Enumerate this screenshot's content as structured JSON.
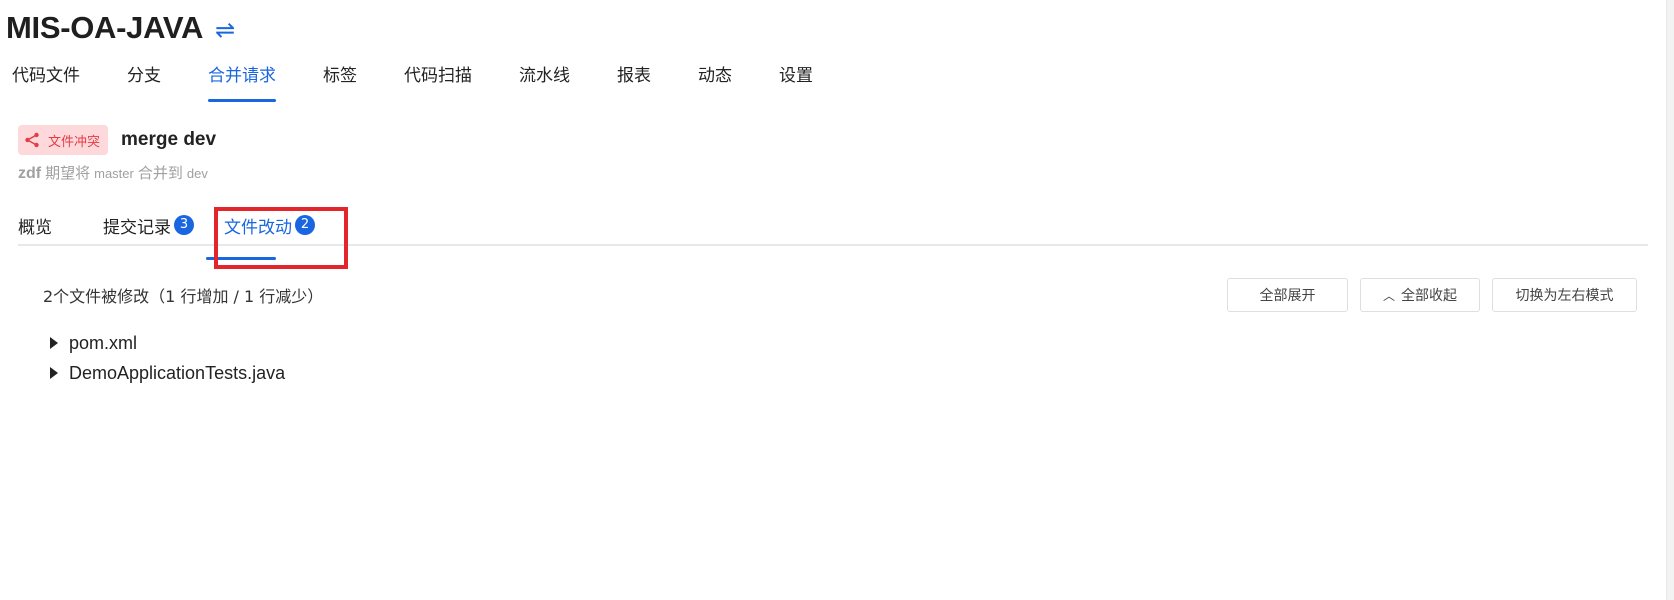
{
  "repo": {
    "title": "MIS-OA-JAVA",
    "switch_icon": "swap-arrows-icon"
  },
  "nav": {
    "items": [
      {
        "label": "代码文件"
      },
      {
        "label": "分支"
      },
      {
        "label": "合并请求"
      },
      {
        "label": "标签"
      },
      {
        "label": "代码扫描"
      },
      {
        "label": "流水线"
      },
      {
        "label": "报表"
      },
      {
        "label": "动态"
      },
      {
        "label": "设置"
      }
    ],
    "active": "合并请求"
  },
  "merge_request": {
    "status_badge": "文件冲突",
    "status_icon": "share-icon",
    "title": "merge dev",
    "author": "zdf",
    "expect_text": "期望将",
    "source_branch": "master",
    "merge_to_text": "合并到",
    "target_branch": "dev"
  },
  "sub_tabs": [
    {
      "label": "概览"
    },
    {
      "label": "提交记录",
      "count": "3"
    },
    {
      "label": "文件改动",
      "count": "2"
    }
  ],
  "sub_tabs_active": "文件改动",
  "changes": {
    "summary": "2个文件被修改（1 行增加 / 1 行减少）",
    "expand_all": "全部展开",
    "collapse_all": "全部收起",
    "switch_mode": "切换为左右模式",
    "files": [
      {
        "name": "pom.xml"
      },
      {
        "name": "DemoApplicationTests.java"
      }
    ]
  },
  "colors": {
    "accent": "#1a66e0",
    "conflict_bg": "#fdd9dc",
    "conflict_text": "#e33c45",
    "highlight": "#e2262c"
  }
}
